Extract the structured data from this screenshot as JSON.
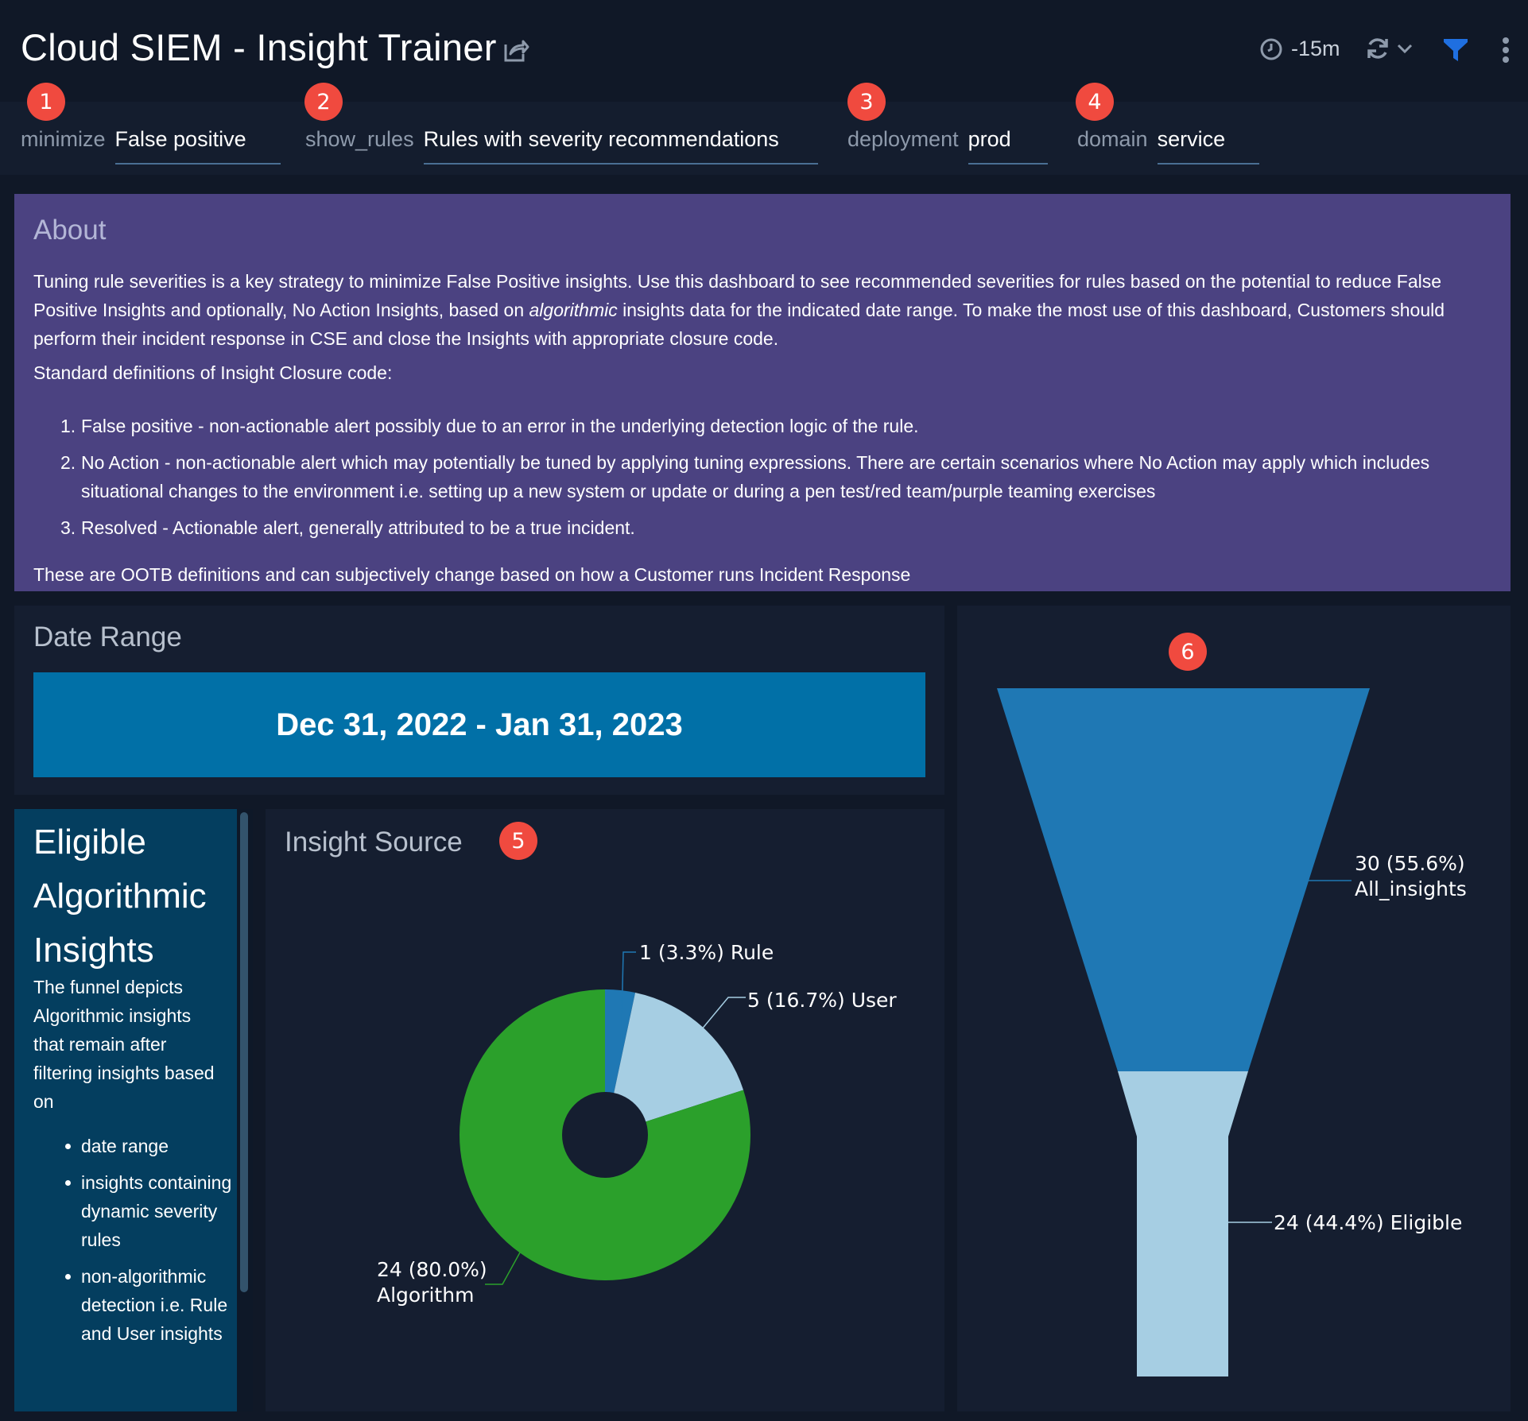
{
  "header": {
    "title": "Cloud SIEM - Insight Trainer",
    "time_range": "-15m"
  },
  "filters": [
    {
      "badge": "1",
      "label": "minimize",
      "value": "False positive"
    },
    {
      "badge": "2",
      "label": "show_rules",
      "value": "Rules with severity recommendations"
    },
    {
      "badge": "3",
      "label": "deployment",
      "value": "prod"
    },
    {
      "badge": "4",
      "label": "domain",
      "value": "service"
    }
  ],
  "about": {
    "title": "About",
    "para_pre": "Tuning rule severities is a key strategy to minimize False Positive insights. Use this dashboard to see recommended severities for rules based on the potential to reduce False Positive Insights and optionally, No Action Insights, based on ",
    "para_em": "algorithmic",
    "para_post": " insights data for the indicated date range. To make the most use of this dashboard, Customers should perform their incident response in CSE and close the Insights with appropriate closure code.",
    "standard_heading": "Standard definitions of Insight Closure code:",
    "definitions": [
      {
        "num": "1.",
        "text": "False positive - non-actionable alert possibly due to an error in the underlying detection logic of the rule."
      },
      {
        "num": "2.",
        "text": "No Action - non-actionable alert which may potentially be tuned by applying tuning expressions. There are certain scenarios where No Action may apply which includes situational changes to the environment i.e. setting up a new system or update or during a pen test/red team/purple teaming exercises"
      },
      {
        "num": "3.",
        "text": "Resolved - Actionable alert, generally attributed to be a true incident."
      }
    ],
    "footer": "These are OOTB definitions and can subjectively change based on how a Customer runs Incident Response"
  },
  "date_range": {
    "title": "Date Range",
    "value": "Dec 31, 2022 - Jan 31, 2023"
  },
  "eligible": {
    "title": "Eligible Algorithmic Insights",
    "description": "The funnel depicts Algorithmic insights that remain after filtering insights based on",
    "bullets": [
      "date range",
      "insights containing dynamic severity rules",
      "non-algorithmic detection i.e. Rule and User insights"
    ]
  },
  "insight_source": {
    "title": "Insight Source",
    "badge": "5"
  },
  "funnel": {
    "badge": "6"
  },
  "chart_data": [
    {
      "type": "pie",
      "title": "Insight Source",
      "slices": [
        {
          "label": "Rule",
          "value": 1,
          "percent": 3.3,
          "color": "#1f78b4",
          "display": "1 (3.3%) Rule"
        },
        {
          "label": "User",
          "value": 5,
          "percent": 16.7,
          "color": "#a6cee3",
          "display": "5 (16.7%) User"
        },
        {
          "label": "Algorithm",
          "value": 24,
          "percent": 80.0,
          "color": "#2ba02b",
          "display_line1": "24 (80.0%)",
          "display_line2": "Algorithm"
        }
      ],
      "donut": true
    },
    {
      "type": "funnel",
      "stages": [
        {
          "label": "All_insights",
          "value": 30,
          "percent": 55.6,
          "color": "#1f78b4",
          "display_line1": "30 (55.6%)",
          "display_line2": "All_insights"
        },
        {
          "label": "Eligible",
          "value": 24,
          "percent": 44.4,
          "color": "#a6cee3",
          "display": "24 (44.4%) Eligible"
        }
      ]
    }
  ]
}
